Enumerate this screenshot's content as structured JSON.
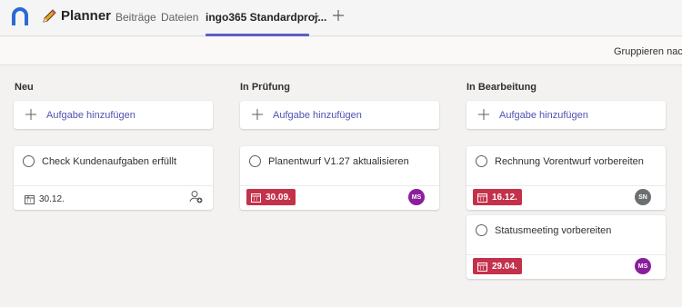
{
  "header": {
    "app_title": "Planner",
    "tabs": [
      {
        "label": "Beiträge"
      },
      {
        "label": "Dateien"
      },
      {
        "label": "ingo365 Standardproj..."
      }
    ]
  },
  "toolbar": {
    "group_label": "Gruppieren nach"
  },
  "colors": {
    "accent": "#5b5fc7",
    "late": "#c4314b",
    "avatar_ms": "#8a1e9c",
    "avatar_sn": "#6b6f72"
  },
  "columns": [
    {
      "title": "Neu",
      "add_label": "Aufgabe hinzufügen",
      "tasks": [
        {
          "title": "Check Kundenaufgaben erfüllt",
          "due": "30.12.",
          "late": false,
          "assignee": ""
        }
      ]
    },
    {
      "title": "In Prüfung",
      "add_label": "Aufgabe hinzufügen",
      "tasks": [
        {
          "title": "Planentwurf V1.27 aktualisieren",
          "due": "30.09.",
          "late": true,
          "assignee": "MS"
        }
      ]
    },
    {
      "title": "In Bearbeitung",
      "add_label": "Aufgabe hinzufügen",
      "tasks": [
        {
          "title": "Rechnung Vorentwurf vorbereiten",
          "due": "16.12.",
          "late": true,
          "assignee": "SN"
        },
        {
          "title": "Statusmeeting vorbereiten",
          "due": "29.04.",
          "late": true,
          "assignee": "MS"
        }
      ]
    }
  ]
}
